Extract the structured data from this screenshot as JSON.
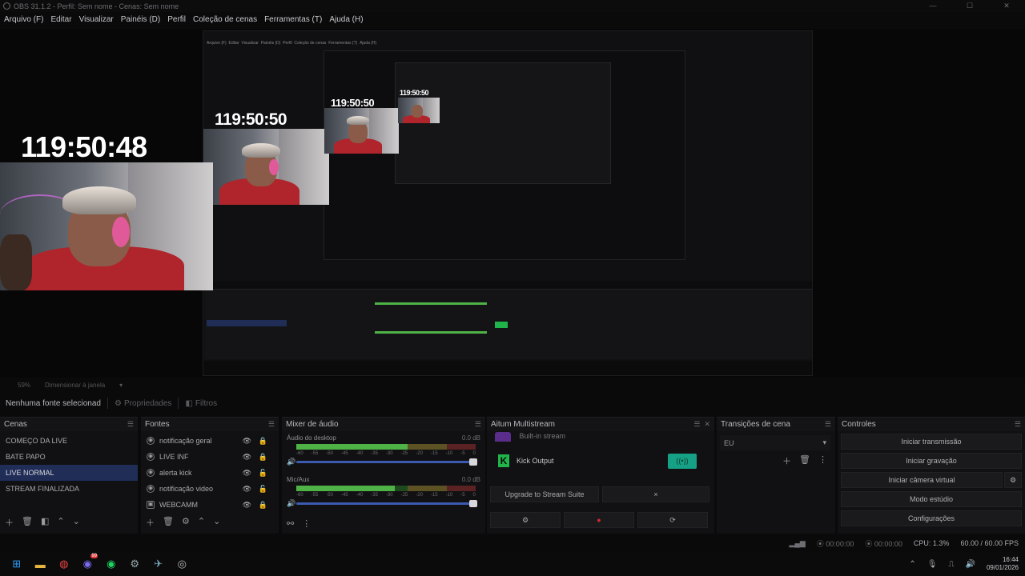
{
  "window": {
    "title": "OBS 31.1.2 - Perfil: Sem nome - Cenas: Sem nome"
  },
  "menu": [
    "Arquivo (F)",
    "Editar",
    "Visualizar",
    "Painéis (D)",
    "Perfil",
    "Coleção de cenas",
    "Ferramentas (T)",
    "Ajuda (H)"
  ],
  "preview": {
    "clock_main": "119:50:48",
    "clock_nested_1": "119:50:50",
    "clock_nested_2": "119:50:50",
    "clock_nested_3": "119:50:50"
  },
  "zoom": {
    "value": "59%",
    "mode": "Dimensionar à janela"
  },
  "source_toolbar": {
    "none_selected": "Nenhuma fonte selecionad",
    "properties": "Propriedades",
    "filters": "Filtros"
  },
  "scenes": {
    "title": "Cenas",
    "items": [
      "COMEÇO DA LIVE",
      "BATE PAPO",
      "LIVE NORMAL",
      "STREAM FINALIZADA"
    ],
    "selected_index": 2
  },
  "sources": {
    "title": "Fontes",
    "items": [
      "notificação geral",
      "LIVE INF",
      "alerta kick",
      "notificação video",
      "WEBCAMM"
    ]
  },
  "mixer": {
    "title": "Mixer de áudio",
    "channels": [
      {
        "name": "Áudio do desktop",
        "db": "0.0 dB",
        "level": 0.62
      },
      {
        "name": "Mic/Aux",
        "db": "0.0 dB",
        "level": 0.55
      }
    ],
    "ticks": [
      "-60",
      "-55",
      "-50",
      "-45",
      "-40",
      "-35",
      "-30",
      "-25",
      "-20",
      "-15",
      "-10",
      "-5",
      "0"
    ]
  },
  "multistream": {
    "title": "Aitum Multistream",
    "partial_row": "Built-in stream",
    "output": "Kick Output",
    "upgrade": "Upgrade to Stream Suite",
    "close": "×"
  },
  "transitions": {
    "title": "Transições de cena",
    "selected": "EU"
  },
  "controls": {
    "title": "Controles",
    "buttons": [
      "Iniciar transmissão",
      "Iniciar gravação",
      "Iniciar câmera virtual",
      "Modo estúdio",
      "Configurações"
    ]
  },
  "status": {
    "stream_time": "00:00:00",
    "rec_time": "00:00:00",
    "cpu": "CPU: 1.3%",
    "fps": "60.00 / 60.00 FPS"
  },
  "taskbar": {
    "time": "16:44",
    "date": "09/01/2026",
    "discord_badge": "99"
  },
  "colors": {
    "accent": "#1f2d57",
    "kick": "#1fb54a",
    "record": "#d42a2a"
  }
}
